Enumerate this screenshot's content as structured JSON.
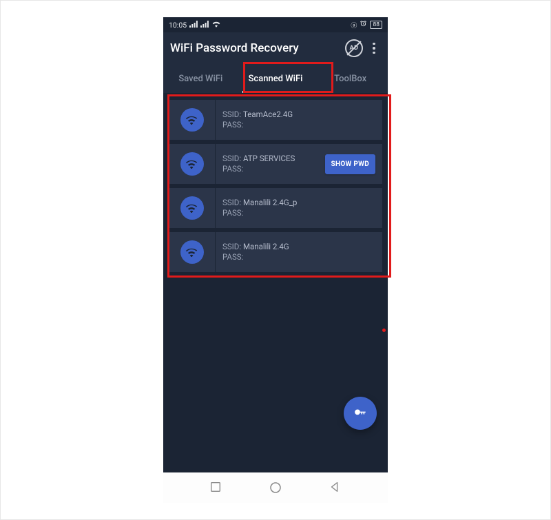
{
  "status": {
    "time": "10:05",
    "battery": "88"
  },
  "app": {
    "title": "WiFi Password Recovery"
  },
  "tabs": [
    {
      "label": "Saved WiFi",
      "active": false
    },
    {
      "label": "Scanned WiFi",
      "active": true
    },
    {
      "label": "ToolBox",
      "active": false
    }
  ],
  "labels": {
    "ssid": "SSID:",
    "pass": "PASS:",
    "show_pwd": "SHOW PWD"
  },
  "networks": [
    {
      "ssid": "TeamAce2.4G",
      "pass": "",
      "show_button": false
    },
    {
      "ssid": "ATP SERVICES",
      "pass": "",
      "show_button": true
    },
    {
      "ssid": "Manalili 2.4G_p",
      "pass": "",
      "show_button": false
    },
    {
      "ssid": "Manalili 2.4G",
      "pass": "",
      "show_button": false
    }
  ]
}
